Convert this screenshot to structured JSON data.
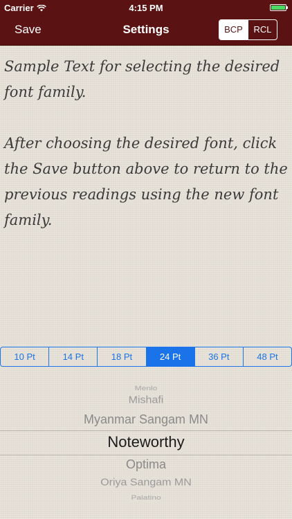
{
  "status_bar": {
    "carrier": "Carrier",
    "time": "4:15 PM"
  },
  "nav": {
    "save_label": "Save",
    "title": "Settings",
    "modes": [
      "BCP",
      "RCL"
    ],
    "selected_mode": "BCP"
  },
  "sample": {
    "paragraph1": "Sample Text for selecting the desired font family.",
    "paragraph2": "After choosing the desired font, click the Save button above to return to the previous readings using the new font family."
  },
  "font_sizes": {
    "options": [
      "10 Pt",
      "14 Pt",
      "18 Pt",
      "24 Pt",
      "36 Pt",
      "48 Pt"
    ],
    "selected": "24 Pt"
  },
  "font_picker": {
    "items": [
      "Menlo",
      "Mishafi",
      "Myanmar Sangam MN",
      "Noteworthy",
      "Optima",
      "Oriya Sangam MN",
      "Palatino"
    ],
    "selected": "Noteworthy"
  },
  "colors": {
    "nav_background": "#5a1212",
    "accent_blue": "#1a73e8",
    "battery_green": "#4cd964"
  }
}
